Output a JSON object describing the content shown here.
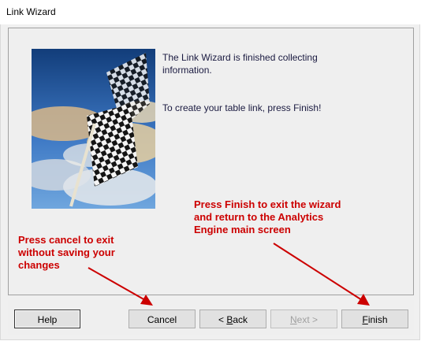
{
  "window": {
    "title": "Link Wizard"
  },
  "wizard": {
    "info_line_1": "The Link Wizard is finished collecting information.",
    "info_line_2": "To create your table link, press Finish!"
  },
  "annotations": {
    "finish_note": "Press Finish to exit the wizard\nand return to the Analytics\nEngine main screen",
    "cancel_note": "Press cancel to exit\nwithout saving your\nchanges"
  },
  "buttons": {
    "help": "Help",
    "cancel": "Cancel",
    "back_prefix": "< ",
    "back_mnemonic": "B",
    "back_rest": "ack",
    "next_mnemonic": "N",
    "next_rest": "ext >",
    "finish_mnemonic": "F",
    "finish_rest": "inish"
  },
  "colors": {
    "annotation": "#cc0000",
    "panel": "#efefef",
    "sky": "#1f5fa8"
  },
  "icons": {
    "wizard_image": "checkered-flag-image",
    "annotation_arrow": "red-arrow-icon"
  }
}
